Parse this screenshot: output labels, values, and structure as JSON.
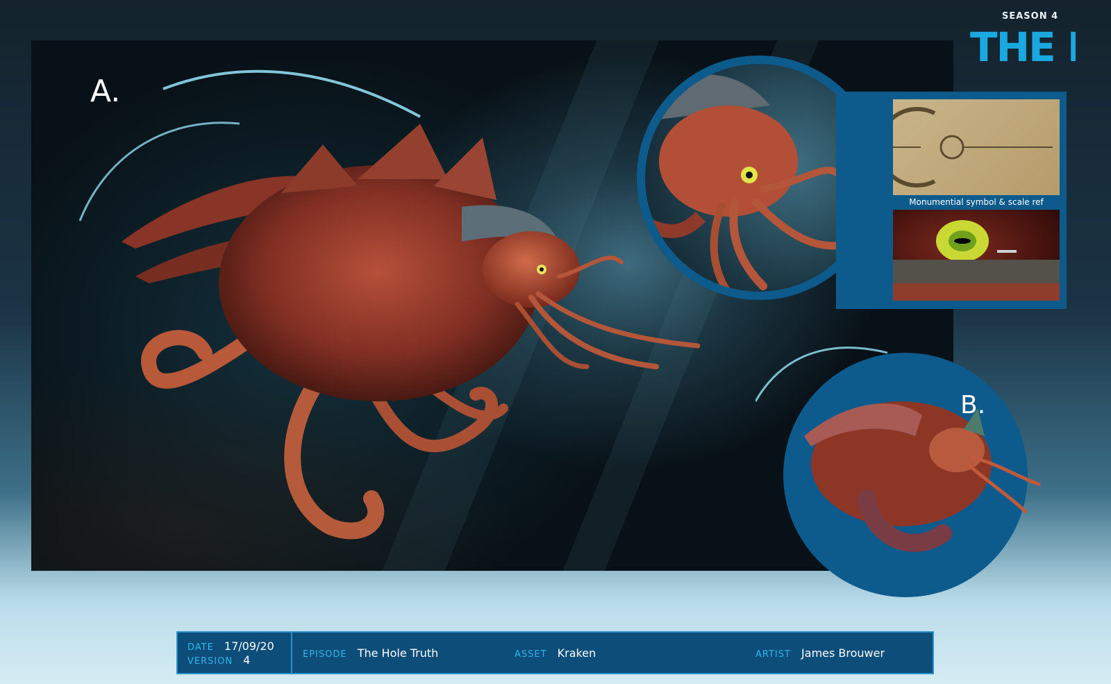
{
  "branding": {
    "season": "SEASON 4",
    "logo_text": "THE DEEP",
    "colors": {
      "accent": "#19a8e0",
      "panel": "#0d5a8c",
      "label": "#2fb6ea"
    }
  },
  "panels": {
    "main_label": "A.",
    "secondary_label": "B.",
    "reference_caption": "Monumential symbol & scale ref"
  },
  "info_bar": {
    "date_label": "DATE",
    "date_value": "17/09/20",
    "version_label": "VERSION",
    "version_value": "4",
    "episode_label": "EPISODE",
    "episode_value": "The Hole Truth",
    "asset_label": "ASSET",
    "asset_value": "Kraken",
    "artist_label": "ARTIST",
    "artist_value": "James Brouwer"
  }
}
